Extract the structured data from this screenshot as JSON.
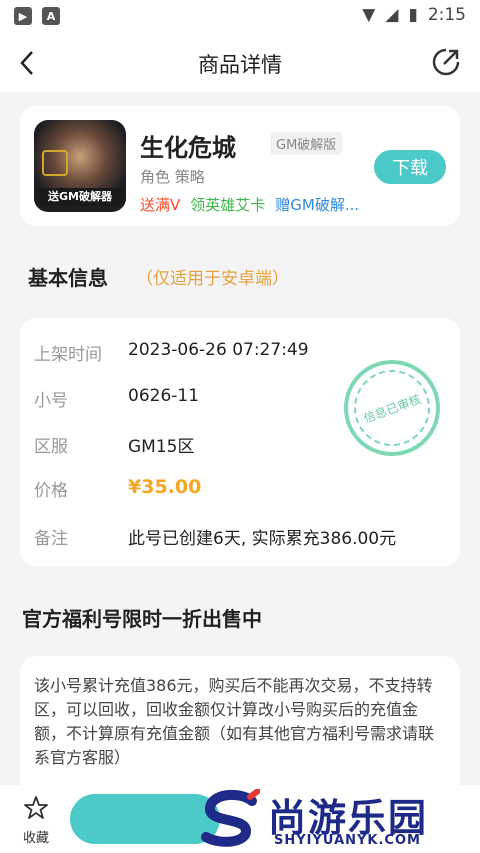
{
  "status": {
    "time": "2:15"
  },
  "nav": {
    "title": "商品详情"
  },
  "game": {
    "icon_text": "送GM破解器",
    "name": "生化危城",
    "tag": "GM破解版",
    "genre": "角色 策略",
    "perks": [
      "送满V",
      "领英雄艾卡",
      "赠GM破解..."
    ],
    "download_label": "下载"
  },
  "basic_info": {
    "title": "基本信息",
    "subtitle": "（仅适用于安卓端）",
    "rows": [
      {
        "label": "上架时间",
        "value": "2023-06-26 07:27:49"
      },
      {
        "label": "小号",
        "value": "0626-11"
      },
      {
        "label": "区服",
        "value": "GM15区"
      },
      {
        "label": "价格",
        "value": "¥35.00"
      },
      {
        "label": "备注",
        "value": "此号已创建6天, 实际累充386.00元"
      }
    ],
    "stamp_text": "信息已审核"
  },
  "welfare": {
    "title": "官方福利号限时一折出售中",
    "description": "该小号累计充值386元，购买后不能再次交易，不支持转区，可以回收，回收金额仅计算改小号购买后的充值金额，不计算原有充值金额（如有其他官方福利号需求请联系官方客服）"
  },
  "bottom": {
    "fav_label": "收藏"
  },
  "watermark": {
    "title": "尚游乐园",
    "url": "SHYIYUANYK.COM"
  },
  "colors": {
    "accent": "#4cc9c9",
    "price": "#f5a623",
    "subtitle": "#e6a23c",
    "brand": "#1f2a88"
  }
}
